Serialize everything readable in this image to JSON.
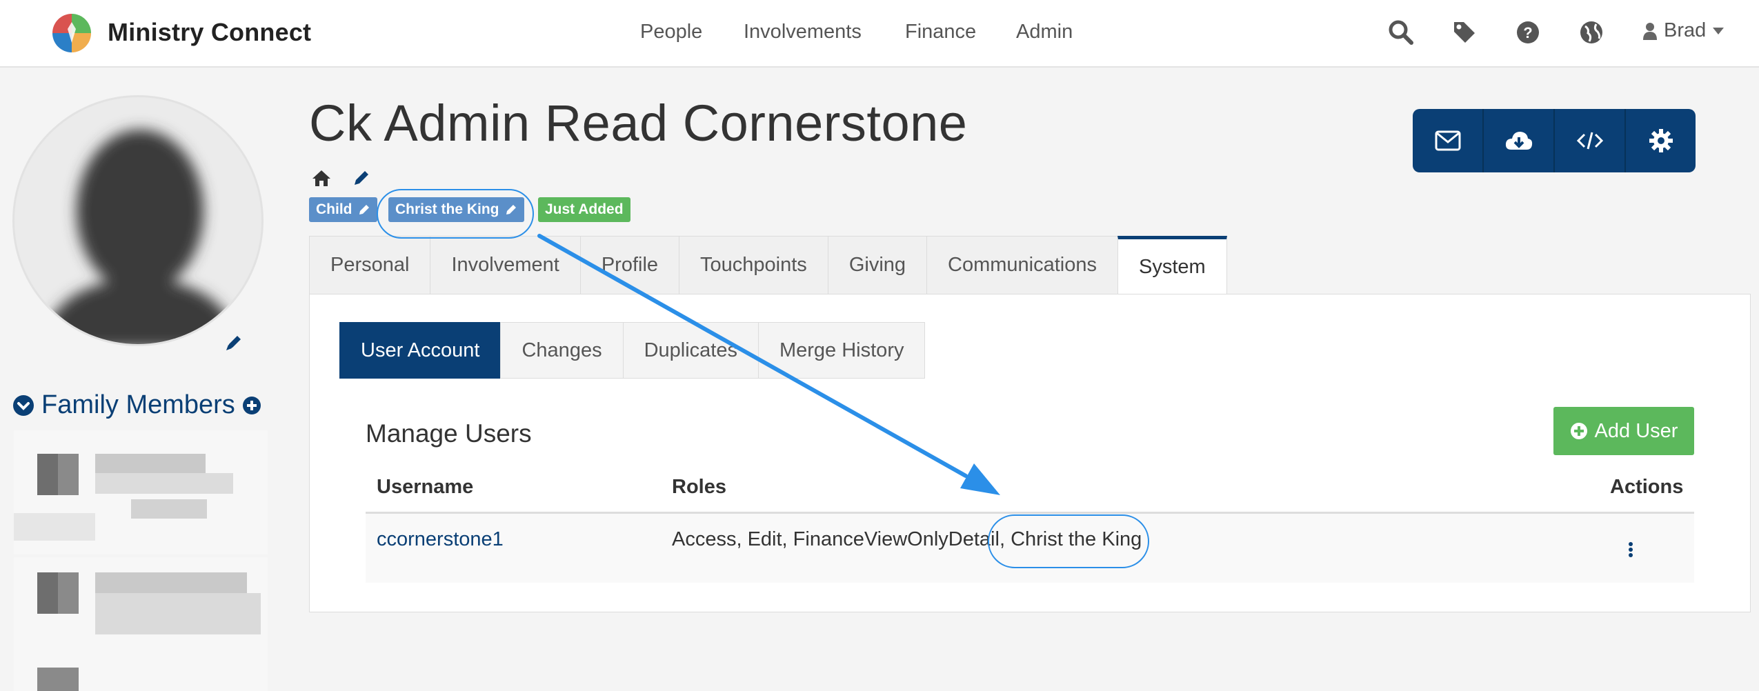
{
  "app": {
    "brand": "Ministry Connect",
    "nav": [
      "People",
      "Involvements",
      "Finance",
      "Admin"
    ],
    "user": "Brad"
  },
  "icons": [
    "search-icon",
    "tag-icon",
    "help-icon",
    "globe-icon",
    "user-icon",
    "caret-down-icon",
    "home-icon",
    "pencil-icon",
    "envelope-icon",
    "cloud-download-icon",
    "code-icon",
    "gear-icon",
    "plus-circle-icon",
    "kebab-icon",
    "chevron-down-icon"
  ],
  "person": {
    "name": "Ck Admin Read Cornerstone",
    "labels": {
      "position": "Child",
      "campus": "Christ the King",
      "status": "Just Added"
    }
  },
  "family": {
    "title": "Family Members"
  },
  "tabs": [
    "Personal",
    "Involvement",
    "Profile",
    "Touchpoints",
    "Giving",
    "Communications",
    "System"
  ],
  "active_tab": "System",
  "subtabs": [
    "User Account",
    "Changes",
    "Duplicates",
    "Merge History"
  ],
  "active_subtab": "User Account",
  "users": {
    "title": "Manage Users",
    "add_label": "Add User",
    "columns": {
      "username": "Username",
      "roles": "Roles",
      "actions": "Actions"
    },
    "rows": [
      {
        "username": "ccornerstone1",
        "roles_main": "Access, Edit, FinanceViewOnlyDetail",
        "roles_campus": ", Christ the King"
      }
    ]
  },
  "colors": {
    "primary": "#0a3f75",
    "label_blue": "#5b8fc9",
    "success": "#5cb85c",
    "annotation": "#2b8fe8"
  }
}
